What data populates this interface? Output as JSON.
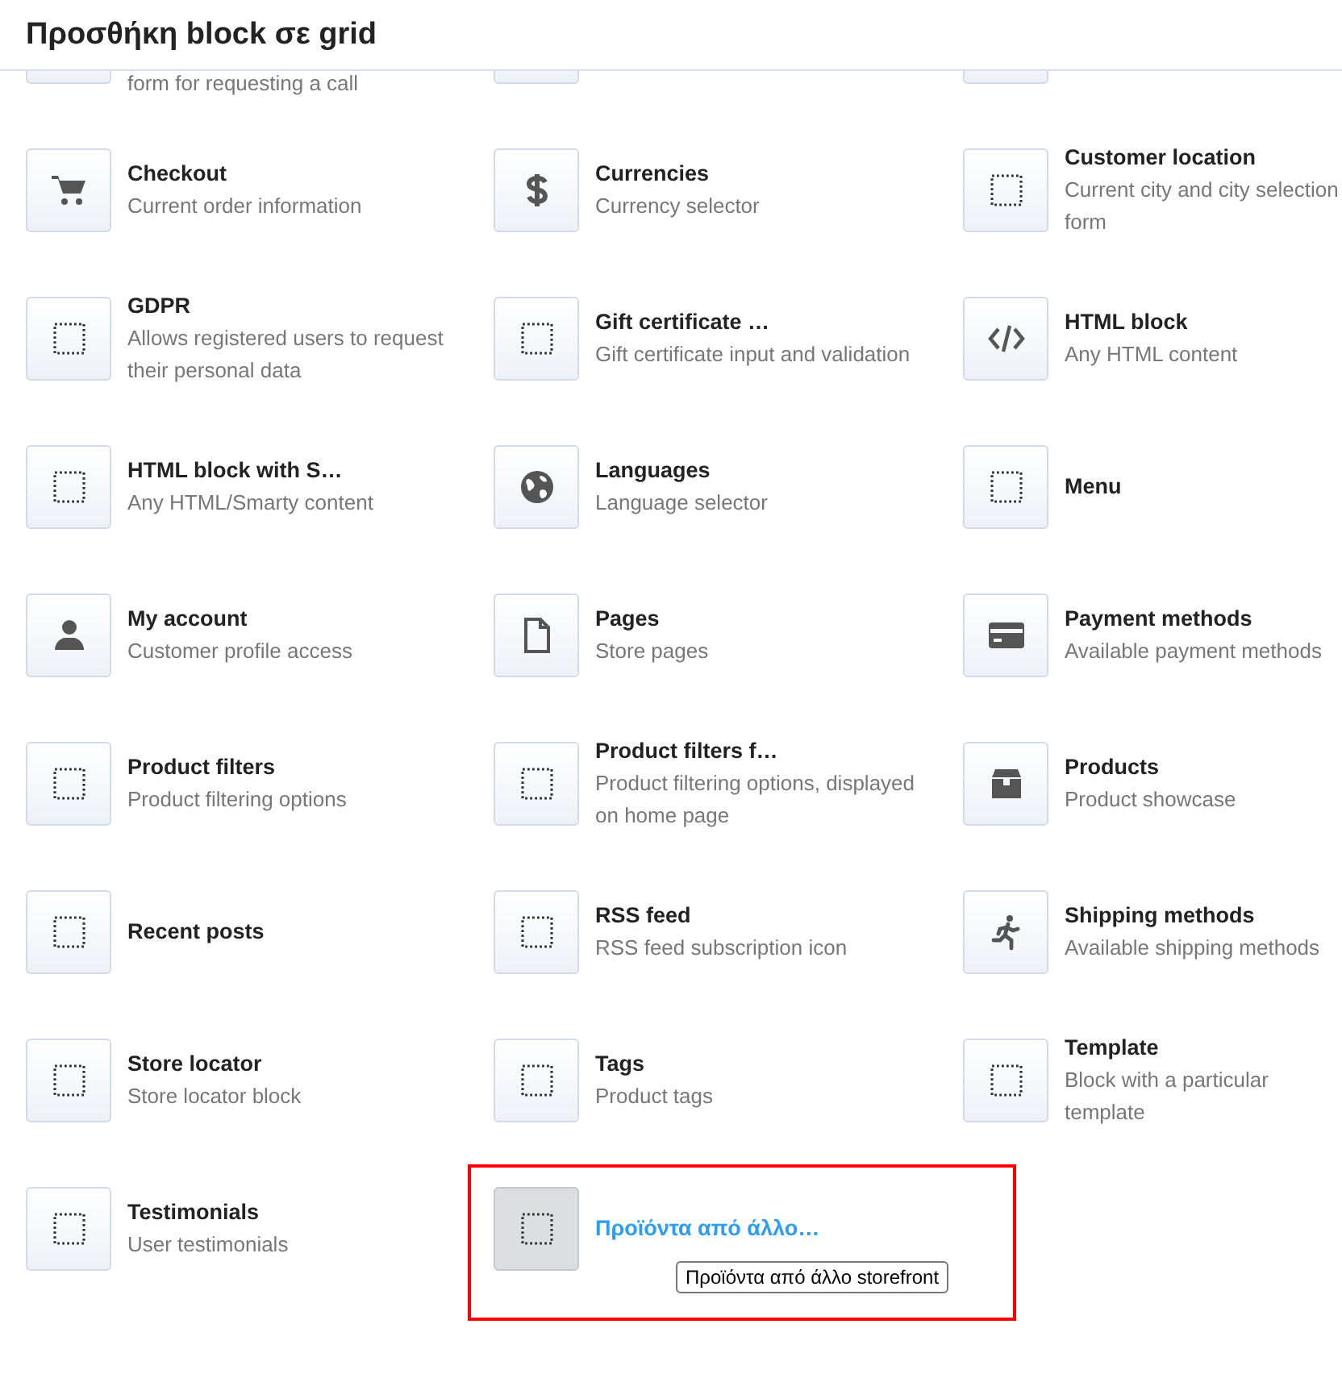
{
  "window": {
    "title": "Προσθήκη block σε grid"
  },
  "blocks": [
    {
      "kind": "partial",
      "description": "form for requesting a call",
      "selected": false
    },
    {
      "kind": "partial",
      "selected": false
    },
    {
      "kind": "partial",
      "selected": false
    },
    {
      "kind": "block",
      "title": "Checkout",
      "description": "Current order information",
      "selected": false
    },
    {
      "kind": "block",
      "title": "Currencies",
      "description": "Currency selector",
      "selected": false
    },
    {
      "kind": "block",
      "title": "Customer location",
      "description": "Current city and city selection form",
      "selected": false
    },
    {
      "kind": "block",
      "title": "GDPR",
      "description": "Allows registered users to request their personal data",
      "selected": false
    },
    {
      "kind": "block",
      "title": "Gift certificate …",
      "description": "Gift certificate input and validation",
      "selected": false
    },
    {
      "kind": "block",
      "title": "HTML block",
      "description": "Any HTML content",
      "selected": false
    },
    {
      "kind": "block",
      "title": "HTML block with S…",
      "description": "Any HTML/Smarty content",
      "selected": false
    },
    {
      "kind": "block",
      "title": "Languages",
      "description": "Language selector",
      "selected": false
    },
    {
      "kind": "block",
      "title": "Menu",
      "selected": false
    },
    {
      "kind": "block",
      "title": "My account",
      "description": "Customer profile access",
      "selected": false
    },
    {
      "kind": "block",
      "title": "Pages",
      "description": "Store pages",
      "selected": false
    },
    {
      "kind": "block",
      "title": "Payment methods",
      "description": "Available payment methods",
      "selected": false
    },
    {
      "kind": "block",
      "title": "Product filters",
      "description": "Product filtering options",
      "selected": false
    },
    {
      "kind": "block",
      "title": "Product filters f…",
      "description": "Product filtering options, displayed on home page",
      "selected": false
    },
    {
      "kind": "block",
      "title": "Products",
      "description": "Product showcase",
      "selected": false
    },
    {
      "kind": "block",
      "title": "Recent posts",
      "selected": false
    },
    {
      "kind": "block",
      "title": "RSS feed",
      "description": "RSS feed subscription icon",
      "selected": false
    },
    {
      "kind": "block",
      "title": "Shipping methods",
      "description": "Available shipping methods",
      "selected": false
    },
    {
      "kind": "block",
      "title": "Store locator",
      "description": "Store locator block",
      "selected": false
    },
    {
      "kind": "block",
      "title": "Tags",
      "description": "Product tags",
      "selected": false
    },
    {
      "kind": "block",
      "title": "Template",
      "description": "Block with a particular template",
      "selected": false
    },
    {
      "kind": "block",
      "title": "Testimonials",
      "description": "User testimonials",
      "selected": false
    },
    {
      "kind": "block",
      "title": "Προϊόντα από άλλο…",
      "tooltip": "Προϊόντα από άλλο storefront",
      "selected": true
    }
  ]
}
